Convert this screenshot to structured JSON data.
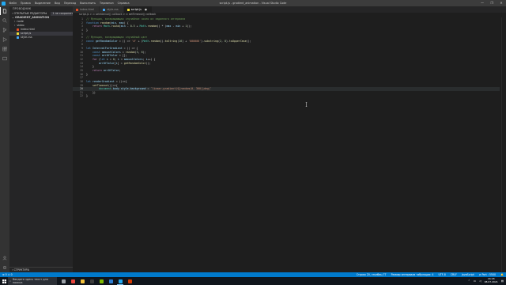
{
  "window": {
    "title": "script.js - gradient_animation - Visual Studio Code",
    "menu": [
      "Файл",
      "Правка",
      "Выделение",
      "Вид",
      "Переход",
      "Выполнить",
      "Терминал",
      "Справка"
    ],
    "controls": [
      "—",
      "❐",
      "✕"
    ]
  },
  "activity_bar": [
    "explorer-icon",
    "search-icon",
    "source-control-icon",
    "run-debug-icon",
    "extensions-icon",
    "remote-icon"
  ],
  "sidebar": {
    "header": "ПРОВОДНИК",
    "open_editors_label": "ОТКРЫТЫЕ РЕДАКТОРЫ",
    "unsaved_badge": "1 не сохранено",
    "folder_label": "GRADIENT_ANIMATION",
    "tree": [
      {
        "label": "node",
        "type": "folder"
      },
      {
        "label": "video",
        "type": "folder"
      },
      {
        "label": "index.html",
        "type": "html"
      },
      {
        "label": "script.js",
        "type": "js"
      },
      {
        "label": "style.css",
        "type": "css"
      }
    ],
    "outline_label": "СТРУКТУРА"
  },
  "tabs": [
    {
      "label": "index.html",
      "active": false
    },
    {
      "label": "style.css",
      "active": false
    },
    {
      "label": "script.js",
      "active": true
    }
  ],
  "breadcrumb": "script.js > ⊙ setInterval() callback > ⊙ setTimeout() callback",
  "code": [
    {
      "n": "1",
      "text": "// Функция, возвращающая случайное число из заданного интервала"
    },
    {
      "n": "2",
      "text": "function random(min, max) {"
    },
    {
      "n": "3",
      "text": "    return Math.round(min - 0.5 + Math.random() * (max - min + 1));"
    },
    {
      "n": "4",
      "text": "}"
    },
    {
      "n": "5",
      "text": ""
    },
    {
      "n": "6",
      "text": "// Функция, возвращающая случайный цвет"
    },
    {
      "n": "7",
      "text": "const getRandomColor = () => '#' + (Math.random().toString(16) + '000000').substring(2, 8).toUpperCase();"
    },
    {
      "n": "8",
      "text": ""
    },
    {
      "n": "9",
      "text": "let IntervalForGradient = () => {"
    },
    {
      "n": "10",
      "text": "    const amountColors = random(3, 6);"
    },
    {
      "n": "11",
      "text": "    const arrOfColor = [];"
    },
    {
      "n": "12",
      "text": "    for (let i = 0; i < amountColors; i++) {"
    },
    {
      "n": "13",
      "text": "        arrOfColor[i] = getRandomColor();"
    },
    {
      "n": "14",
      "text": "    }"
    },
    {
      "n": "15",
      "text": "    return arrOfColor;"
    },
    {
      "n": "16",
      "text": "}"
    },
    {
      "n": "17",
      "text": ""
    },
    {
      "n": "18",
      "text": "let renderGradient = ()=>{"
    },
    {
      "n": "19",
      "text": "    setTimeout(()=>{"
    },
    {
      "n": "20",
      "text": "        document.body.style.background = `linear-gradient(${random(0, 360)}deg)`"
    },
    {
      "n": "21",
      "text": "    })"
    },
    {
      "n": "22",
      "text": "}"
    }
  ],
  "current_line": "20",
  "statusbar": {
    "left": [
      "⊗ 0 ⚠ 0"
    ],
    "right": [
      "Строка 20, столбец 77",
      "Размер интервала табуляции: 4",
      "UTF-8",
      "CRLF",
      "JavaScript",
      "⊘ Port : 5500",
      "🔔"
    ]
  },
  "taskbar": {
    "search_placeholder": "Введите здесь текст для поиска",
    "apps": [
      {
        "name": "task-view",
        "color": "#9aa0a6"
      },
      {
        "name": "chrome",
        "color": "#e8453c"
      },
      {
        "name": "explorer",
        "color": "#f3c13a"
      },
      {
        "name": "terminal",
        "color": "#3c3c3c"
      },
      {
        "name": "media",
        "color": "#7fba00"
      },
      {
        "name": "photos",
        "color": "#2d7dd2"
      },
      {
        "name": "vscode",
        "color": "#23a9f2"
      },
      {
        "name": "recorder",
        "color": "#d83b01"
      }
    ],
    "time": "16:18",
    "date": "08.07.2021"
  },
  "colors": {
    "accent": "#007acc",
    "editor_bg": "#1e1e1e",
    "sidebar_bg": "#252526"
  }
}
